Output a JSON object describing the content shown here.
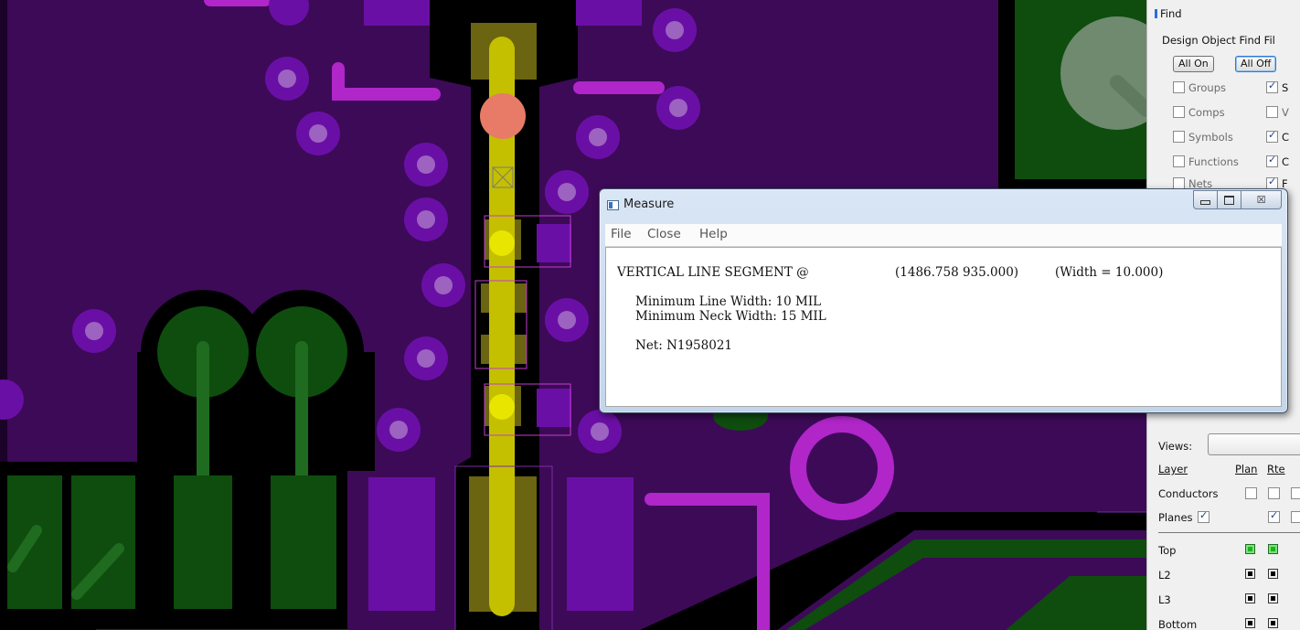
{
  "measure_window": {
    "title": "Measure",
    "menu": [
      "File",
      "Close",
      "Help"
    ],
    "close_glyph": "☒",
    "heading": "VERTICAL LINE SEGMENT @",
    "coords": "(1486.758 935.000)",
    "width_text": "(Width = 10.000)",
    "min_line_width": "Minimum Line Width: 10 MIL",
    "min_neck_width": "Minimum Neck Width: 15 MIL",
    "net": "Net: N1958021"
  },
  "find_panel": {
    "title": "Find",
    "group_title": "Design Object Find Fil",
    "all_on": "All On",
    "all_off": "All Off",
    "filters": [
      {
        "label": "Groups",
        "checked": false,
        "right_label": "S",
        "right_checked": true
      },
      {
        "label": "Comps",
        "checked": false,
        "right_label": "V",
        "right_checked": false
      },
      {
        "label": "Symbols",
        "checked": false,
        "right_label": "C",
        "right_checked": true
      },
      {
        "label": "Functions",
        "checked": false,
        "right_label": "C",
        "right_checked": true
      },
      {
        "label": "Nets",
        "checked": false,
        "right_label": "F",
        "right_checked": true
      }
    ]
  },
  "visibility_panel": {
    "views_label": "Views:",
    "col_layer": "Layer",
    "col_plan": "Plan",
    "col_rte": "Rte",
    "conductors_label": "Conductors",
    "planes_label": "Planes",
    "layers": [
      {
        "name": "Top",
        "color": "#1ab51a"
      },
      {
        "name": "L2",
        "color": "#000000"
      },
      {
        "name": "L3",
        "color": "#000000"
      },
      {
        "name": "Bottom",
        "color": "#000000"
      }
    ]
  },
  "colors": {
    "board": "#3d0a57",
    "antipad": "#000000",
    "top_copper": "#0e4d0e",
    "pad_purple": "#6a0fa6",
    "trace_magenta": "#b026c9",
    "highlight": "#c4c000"
  }
}
